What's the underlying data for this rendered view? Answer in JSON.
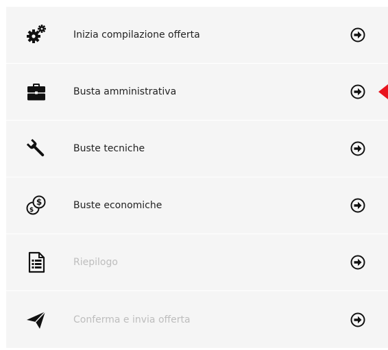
{
  "menu": {
    "items": [
      {
        "label": "Inizia compilazione offerta",
        "icon": "cogs-icon",
        "enabled": true
      },
      {
        "label": "Busta amministrativa",
        "icon": "briefcase-icon",
        "enabled": true,
        "current": true
      },
      {
        "label": "Buste tecniche",
        "icon": "wrench-icon",
        "enabled": true
      },
      {
        "label": "Buste economiche",
        "icon": "money-icon",
        "enabled": true
      },
      {
        "label": "Riepilogo",
        "icon": "document-list-icon",
        "enabled": false
      },
      {
        "label": "Conferma e invia offerta",
        "icon": "paper-plane-icon",
        "enabled": false
      }
    ],
    "go_icon": "arrow-circle-right-icon"
  },
  "colors": {
    "row_background": "#f5f5f5",
    "text": "#222222",
    "text_disabled": "#bdbdbd",
    "icon": "#111111",
    "current_marker": "#e8141e"
  }
}
